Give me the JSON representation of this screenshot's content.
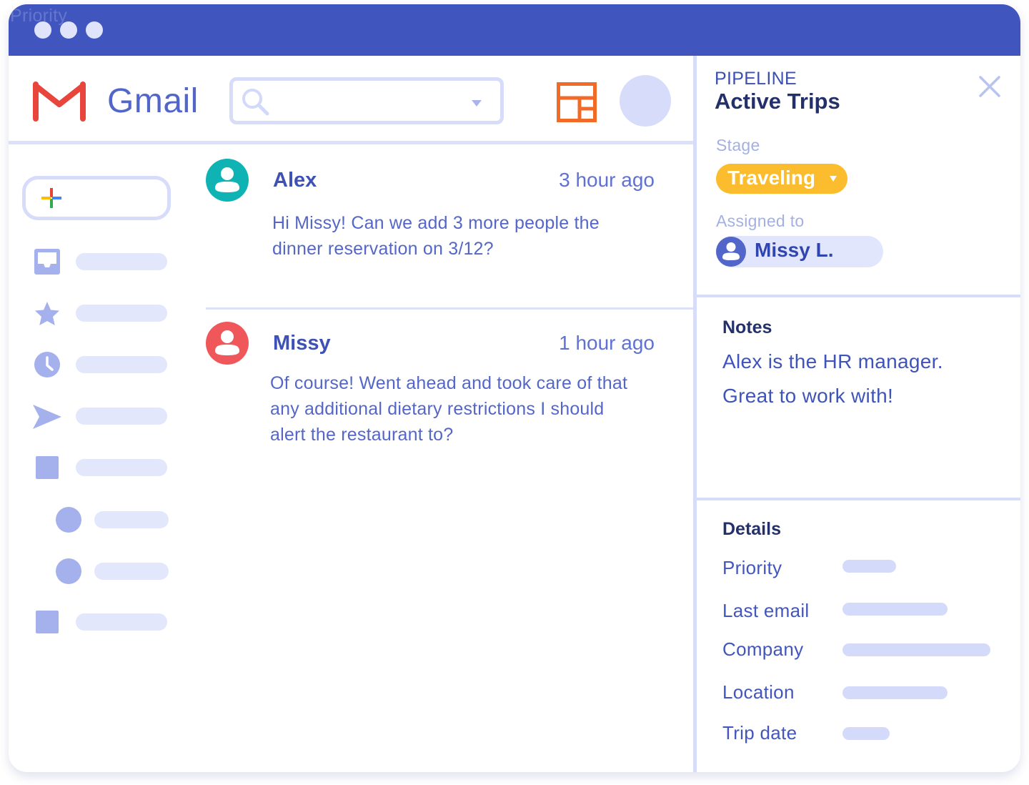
{
  "window": {
    "titlebar_color": "#4155be",
    "ghost_text": "Priority",
    "controls": [
      "dot-1",
      "dot-2",
      "dot-3"
    ]
  },
  "header": {
    "app_name": "Gmail",
    "search": {
      "value": "",
      "placeholder": ""
    },
    "icons": [
      "gmail-logo-icon",
      "search-icon",
      "caret-down-icon",
      "layout-icon",
      "avatar"
    ]
  },
  "sidebar": {
    "compose_icon": "plus-icon",
    "items": [
      {
        "icon": "inbox-icon"
      },
      {
        "icon": "star-icon"
      },
      {
        "icon": "clock-icon"
      },
      {
        "icon": "send-icon"
      },
      {
        "icon": "square-icon"
      },
      {
        "icon": "circle-icon"
      },
      {
        "icon": "circle-icon"
      },
      {
        "icon": "square-icon"
      }
    ]
  },
  "messages": [
    {
      "sender": "Alex",
      "time": "3 hour ago",
      "body_lines": [
        "Hi Missy! Can we add 3 more people the",
        "dinner reservation on 3/12?"
      ],
      "avatar_color": "#0fb3b3"
    },
    {
      "sender": "Missy",
      "time": "1 hour ago",
      "body_lines": [
        "Of course! Went ahead and took care of that",
        "any additional dietary restrictions I should",
        "alert the restaurant to?"
      ],
      "avatar_color": "#f0575a"
    }
  ],
  "panel": {
    "pipeline_label": "PIPELINE",
    "board_title": "Active Trips",
    "stage_label": "Stage",
    "stage_value": "Traveling",
    "stage_color": "#fbbd2e",
    "assigned_label": "Assigned to",
    "assignee": "Missy L.",
    "notes_title": "Notes",
    "notes_lines": [
      "Alex is the HR manager.",
      "Great to work with!"
    ],
    "details_title": "Details",
    "details": [
      {
        "label": "Priority"
      },
      {
        "label": "Last email"
      },
      {
        "label": "Company"
      },
      {
        "label": "Location"
      },
      {
        "label": "Trip date"
      }
    ]
  }
}
